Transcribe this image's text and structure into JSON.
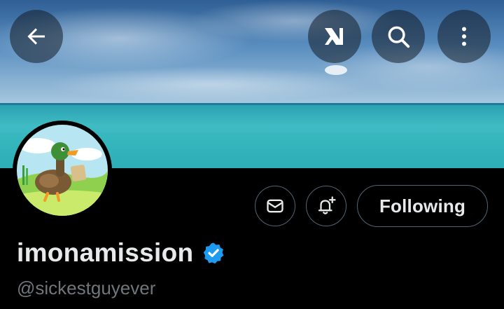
{
  "profile": {
    "display_name": "imonamission",
    "handle": "@sickestguyever",
    "verified": true
  },
  "actions": {
    "following_label": "Following"
  },
  "icons": {
    "back": "arrow-left-icon",
    "grok": "grok-logo-icon",
    "search": "search-icon",
    "more": "more-vertical-icon",
    "message": "envelope-icon",
    "notify": "bell-plus-icon",
    "verified": "verified-badge-icon"
  },
  "colors": {
    "background": "#000000",
    "text_primary": "#e7e9ea",
    "text_secondary": "#71767b",
    "button_border": "#536471",
    "verified_blue": "#1d9bf0"
  }
}
